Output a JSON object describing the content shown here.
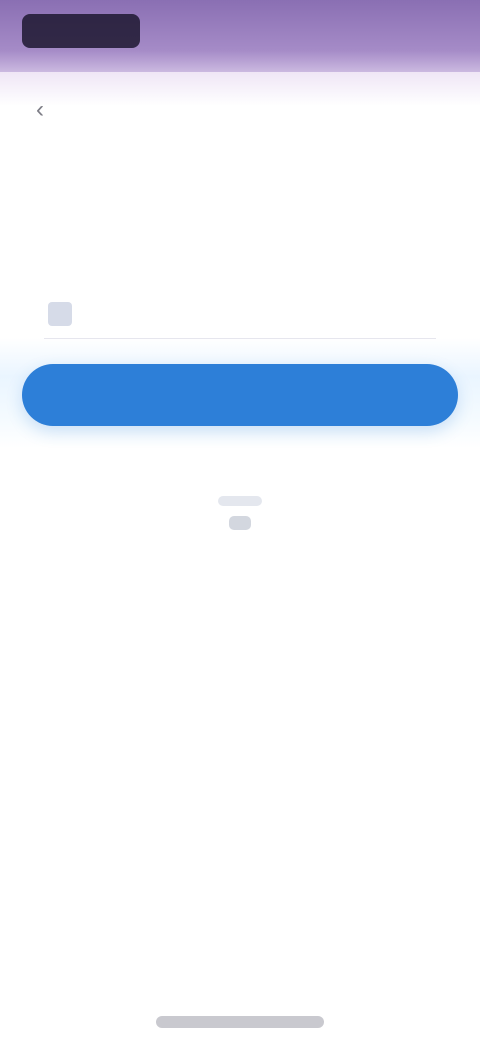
{
  "status_bar": {
    "time": ""
  },
  "app_bar": {
    "back_icon": "chevron-left-icon",
    "title": ""
  },
  "instructions": {
    "line1": "",
    "line2": ""
  },
  "form": {
    "input_icon": "mail-icon",
    "email_value": "",
    "email_placeholder": ""
  },
  "actions": {
    "submit_label": "",
    "left_link": "",
    "right_link": ""
  },
  "colors": {
    "accent": "#2d7fd8",
    "header_purple": "#8a6fb3",
    "text_dark": "#2d2d35",
    "text_muted": "#666670",
    "background": "#ffffff"
  }
}
